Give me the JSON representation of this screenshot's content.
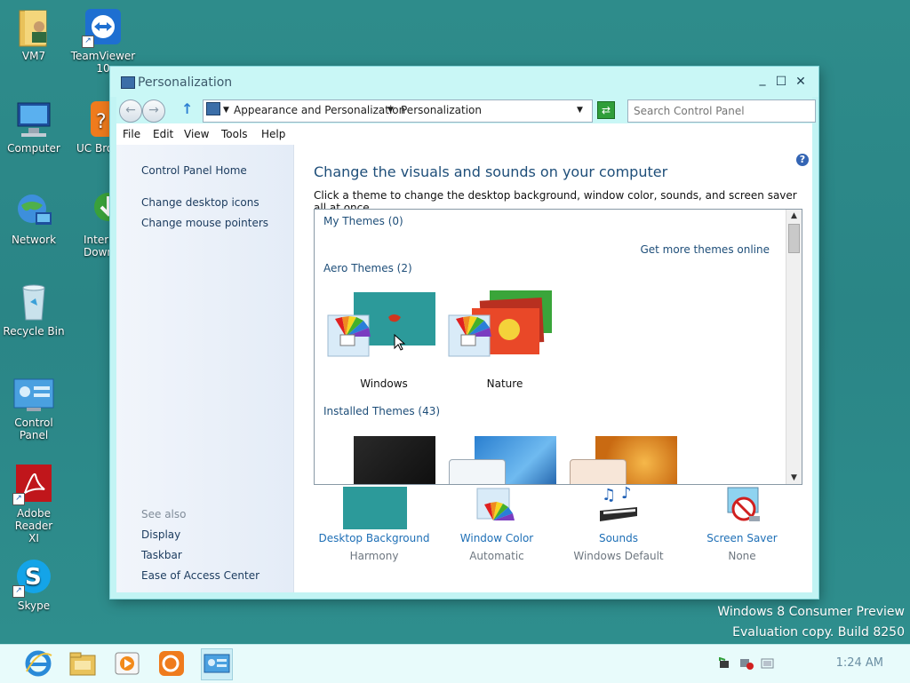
{
  "desktop": {
    "icons": [
      {
        "label": "VM7"
      },
      {
        "label": "TeamViewer\n10"
      },
      {
        "label": "Computer"
      },
      {
        "label": "UC Bro"
      },
      {
        "label": "Network"
      },
      {
        "label": "Intern\nDown"
      },
      {
        "label": "Recycle Bin"
      },
      {
        "label": "Control Panel"
      },
      {
        "label": "Adobe Reader\nXI"
      },
      {
        "label": "Skype"
      }
    ],
    "watermark_line1": "Windows 8 Consumer Preview",
    "watermark_line2": "Evaluation copy. Build 8250"
  },
  "window": {
    "title": "Personalization",
    "controls": {
      "minimize": "_",
      "maximize": "☐",
      "close": "✕"
    },
    "breadcrumb": [
      "Appearance and Personalization",
      "Personalization"
    ],
    "search_placeholder": "Search Control Panel",
    "menu": [
      "File",
      "Edit",
      "View",
      "Tools",
      "Help"
    ],
    "left_links": [
      "Control Panel Home",
      "Change desktop icons",
      "Change mouse pointers"
    ],
    "see_also_title": "See also",
    "see_also": [
      "Display",
      "Taskbar",
      "Ease of Access Center"
    ],
    "heading": "Change the visuals and sounds on your computer",
    "subheading": "Click a theme to change the desktop background, window color, sounds, and screen saver all at once.",
    "help_glyph": "?",
    "themes": {
      "my_themes": "My Themes (0)",
      "get_more": "Get more themes online",
      "aero_themes": "Aero Themes (2)",
      "aero_items": [
        "Windows",
        "Nature"
      ],
      "installed_themes": "Installed Themes (43)"
    },
    "bottom": [
      {
        "label": "Desktop Background",
        "value": "Harmony"
      },
      {
        "label": "Window Color",
        "value": "Automatic"
      },
      {
        "label": "Sounds",
        "value": "Windows Default"
      },
      {
        "label": "Screen Saver",
        "value": "None"
      }
    ]
  },
  "taskbar": {
    "apps": [
      "internet-explorer-icon",
      "file-explorer-icon",
      "media-player-icon",
      "uc-browser-icon",
      "control-panel-icon"
    ],
    "clock": "1:24 AM"
  },
  "colors": {
    "desktop": "#2e8c8b",
    "window_frame": "#c2f4f4",
    "link": "#1e4e79",
    "bottom_link": "#1e6fb6"
  }
}
